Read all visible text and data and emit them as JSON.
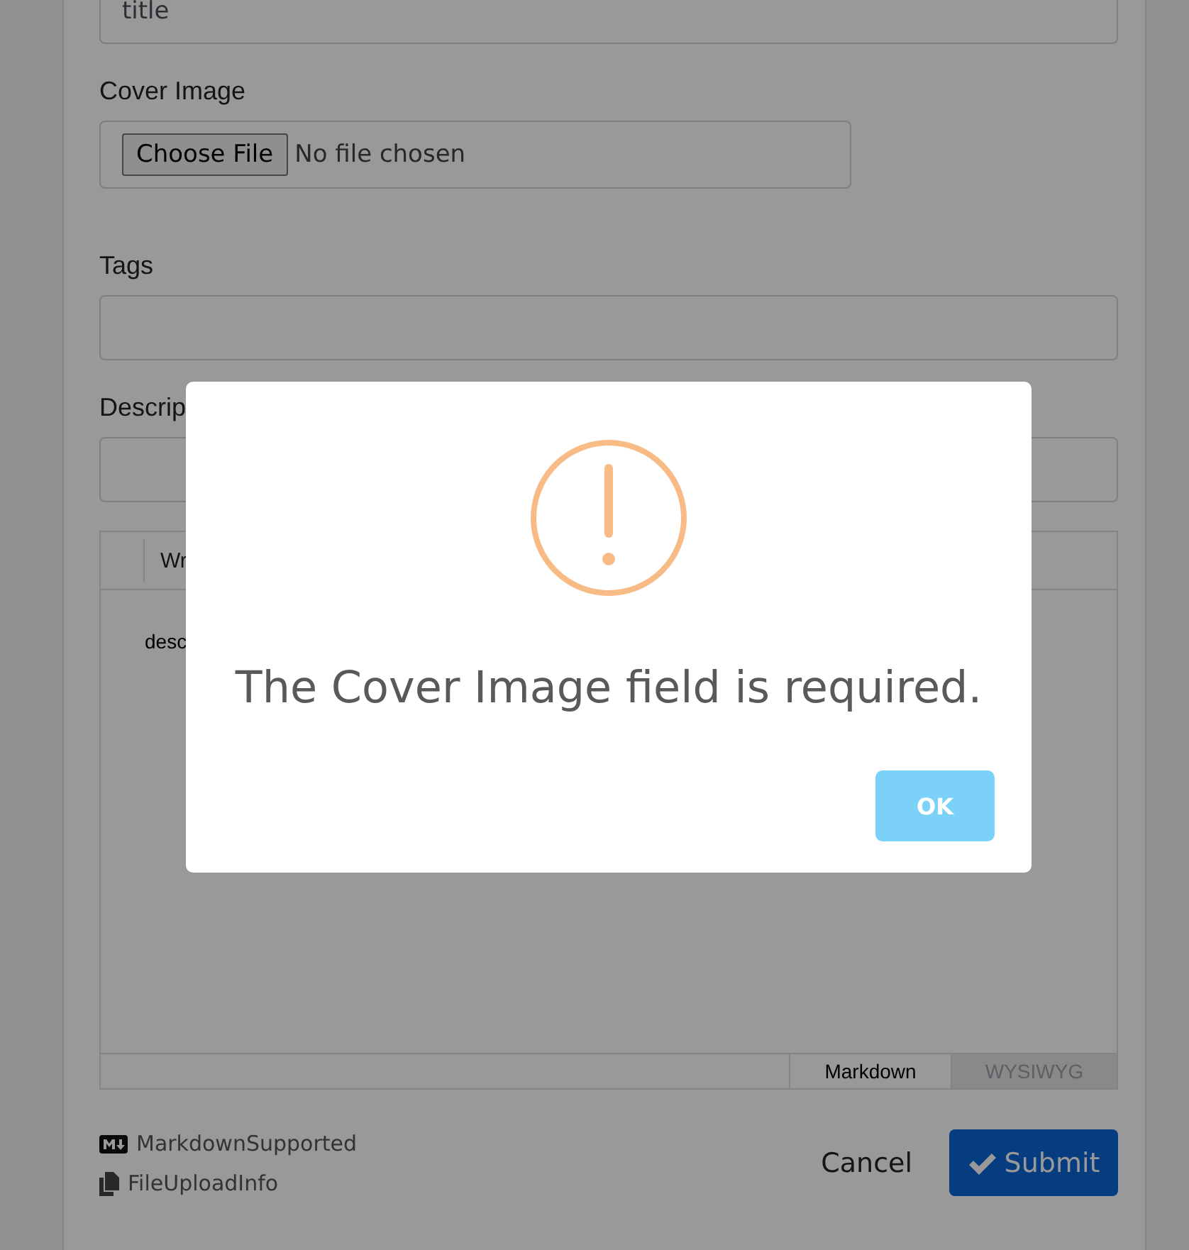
{
  "form": {
    "title_field": {
      "value": "title"
    },
    "cover_image": {
      "label": "Cover Image",
      "button": "Choose File",
      "status": "No file chosen"
    },
    "tags": {
      "label": "Tags"
    },
    "description": {
      "label": "Descrip"
    },
    "editor": {
      "toolbar_tab": "Wr",
      "content": "desc",
      "modes": [
        {
          "label": "Markdown",
          "selected": true
        },
        {
          "label": "WYSIWYG",
          "selected": false
        }
      ]
    },
    "hints": [
      {
        "kind": "markdown",
        "text": "MarkdownSupported"
      },
      {
        "kind": "file",
        "text": "FileUploadInfo"
      }
    ],
    "cancel": "Cancel",
    "submit": "Submit"
  },
  "dialog": {
    "message": "The Cover Image field is required.",
    "button": "OK"
  }
}
